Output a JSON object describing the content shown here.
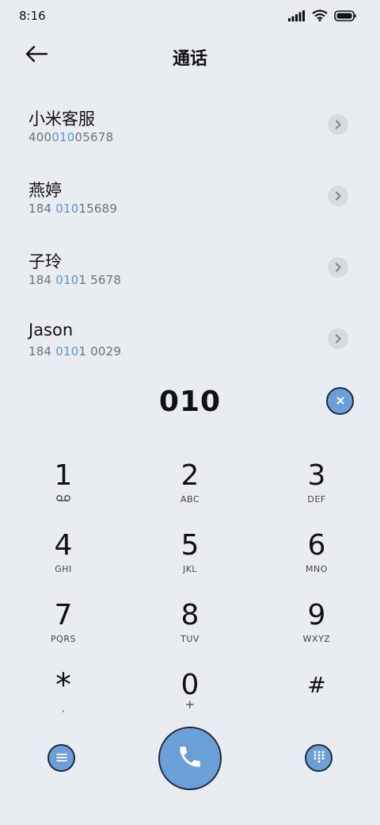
{
  "status_bar": {
    "time": "8:16",
    "icons": [
      "signal-icon",
      "wifi-icon",
      "battery-icon"
    ]
  },
  "header": {
    "title": "通话",
    "back_icon": "arrow-left-icon"
  },
  "contacts": [
    {
      "name": "小米客服",
      "number_pre": "400",
      "number_match": "010",
      "number_post": "05678"
    },
    {
      "name": "燕婷",
      "number_pre": "184 ",
      "number_match": "010",
      "number_post": "15689"
    },
    {
      "name": "子玲",
      "number_pre": "184 ",
      "number_match": "010",
      "number_post": "1 5678"
    },
    {
      "name": "Jason",
      "number_pre": "184 ",
      "number_match": "010",
      "number_post": "1 0029"
    }
  ],
  "dial": {
    "digits": "010"
  },
  "keypad": {
    "keys": [
      {
        "digit": "1",
        "letters": ""
      },
      {
        "digit": "2",
        "letters": "ABC"
      },
      {
        "digit": "3",
        "letters": "DEF"
      },
      {
        "digit": "4",
        "letters": "GHI"
      },
      {
        "digit": "5",
        "letters": "JKL"
      },
      {
        "digit": "6",
        "letters": "MNO"
      },
      {
        "digit": "7",
        "letters": "PQRS"
      },
      {
        "digit": "8",
        "letters": "TUV"
      },
      {
        "digit": "9",
        "letters": "WXYZ"
      },
      {
        "digit": "*",
        "letters": ","
      },
      {
        "digit": "0",
        "letters": "+"
      },
      {
        "digit": "#",
        "letters": ""
      }
    ]
  },
  "colors": {
    "background": "#e9edf2",
    "accent": "#6b9fd8",
    "match_highlight": "#5f93cf",
    "secondary_text": "#6f7378"
  }
}
